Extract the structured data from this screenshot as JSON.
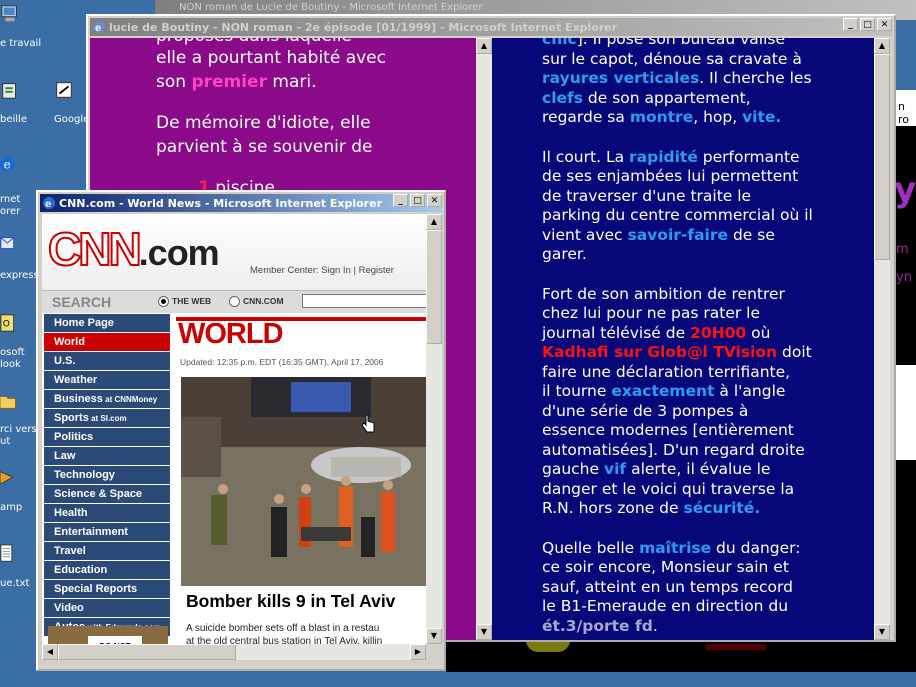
{
  "desktop": {
    "icons": [
      {
        "label": "e travail",
        "icon": "my-computer-icon"
      },
      {
        "label": "beille",
        "icon": "recycle-bin-icon"
      },
      {
        "label": "Google",
        "icon": "google-shortcut-icon"
      },
      {
        "label": "rnet",
        "label2": "orer",
        "icon": "internet-explorer-icon"
      },
      {
        "label": "express",
        "icon": "outlook-express-icon"
      },
      {
        "label": "osoft",
        "label2": "look",
        "icon": "outlook-icon"
      },
      {
        "label": "rci vers",
        "label2": "ut",
        "icon": "folder-shortcut-icon"
      },
      {
        "label": "amp",
        "icon": "winamp-icon"
      },
      {
        "label": "ue.txt",
        "icon": "text-file-icon"
      }
    ],
    "bg_window_title": "NON roman de Lucie de Boutiny - Microsoft Internet Explorer",
    "right_fragments": [
      "n ro",
      "y",
      "m",
      "yn"
    ]
  },
  "lucie_window": {
    "title": "lucie de Boutiny - NON roman - 2e épisode [01/1999] - Microsoft Internet Explorer",
    "left_lines": [
      {
        "text": "elle a pourtant habité avec"
      },
      {
        "pre": "son ",
        "hl": "premier",
        "post": " mari."
      }
    ],
    "left_para2": [
      "De mémoire d'idiote, elle",
      "parvient à   se souvenir de"
    ],
    "left_partial_top": "proposés dans laquelle",
    "left_list": {
      "num": "1",
      "text": " piscine"
    },
    "right_top": {
      "hl1": "chic",
      "t1": "]. Il pose son bureau valise"
    },
    "right_p1": [
      [
        {
          "t": "sur le capot, dénoue sa cravate à"
        }
      ],
      [
        {
          "h": "rayures verticales"
        },
        {
          "t": ". Il cherche les"
        }
      ],
      [
        {
          "h": "clefs"
        },
        {
          "t": " de son appartement,"
        }
      ],
      [
        {
          "t": "regarde sa "
        },
        {
          "h": "montre"
        },
        {
          "t": ", hop, "
        },
        {
          "h": "vite."
        }
      ]
    ],
    "right_p2": [
      [
        {
          "t": "Il court. La "
        },
        {
          "h": "rapidité"
        },
        {
          "t": " performante"
        }
      ],
      [
        {
          "t": "de ses enjambées lui permettent"
        }
      ],
      [
        {
          "t": "de traverser d'une traite le"
        }
      ],
      [
        {
          "t": "parking du centre commercial où il"
        }
      ],
      [
        {
          "t": "vient avec "
        },
        {
          "h": "savoir-faire"
        },
        {
          "t": " de se"
        }
      ],
      [
        {
          "t": "garer."
        }
      ]
    ],
    "right_p3": [
      [
        {
          "t": "Fort de son ambition de rentrer"
        }
      ],
      [
        {
          "t": "chez lui pour ne pas rater le"
        }
      ],
      [
        {
          "t": "journal télévisé de "
        },
        {
          "r": "20H00"
        },
        {
          "t": " où"
        }
      ],
      [
        {
          "r": "Kadhafi sur Glob@l TVision"
        },
        {
          "t": " doit"
        }
      ],
      [
        {
          "t": "faire une déclaration terrifiante,"
        }
      ],
      [
        {
          "t": "il tourne "
        },
        {
          "h": "exactement"
        },
        {
          "t": " à l'angle"
        }
      ],
      [
        {
          "t": "d'une série de 3 pompes à"
        }
      ],
      [
        {
          "t": "essence modernes [entièrement"
        }
      ],
      [
        {
          "t": "automatisées]. D'un regard droite"
        }
      ],
      [
        {
          "t": "gauche "
        },
        {
          "h": "vif"
        },
        {
          "t": " alerte, il évalue le"
        }
      ],
      [
        {
          "t": "danger et le voici qui traverse la"
        }
      ],
      [
        {
          "t": "R.N. hors zone de "
        },
        {
          "h": "sécurité."
        }
      ]
    ],
    "right_p4": [
      [
        {
          "t": "Quelle belle "
        },
        {
          "h": "maîtrise"
        },
        {
          "t": " du danger:"
        }
      ],
      [
        {
          "t": "ce soir encore, Monsieur sain et"
        }
      ],
      [
        {
          "t": "sauf, atteint en un temps record"
        }
      ],
      [
        {
          "t": "le B1-Emeraude en direction du"
        }
      ],
      [
        {
          "g": "ét.3/porte fd"
        },
        {
          "t": "."
        }
      ]
    ]
  },
  "cnn_window": {
    "title": "CNN.com - World News - Microsoft Internet Explorer",
    "logo": "CNN.com",
    "member_center": "Member Center: Sign In | Register",
    "search_label": "SEARCH",
    "radio_web": "THE WEB",
    "radio_cnn": "CNN.COM",
    "nav": [
      {
        "label": "Home Page"
      },
      {
        "label": "World",
        "selected": true
      },
      {
        "label": "U.S."
      },
      {
        "label": "Weather"
      },
      {
        "label": "Business",
        "suffix": " at CNNMoney"
      },
      {
        "label": "Sports",
        "suffix": " at SI.com"
      },
      {
        "label": "Politics"
      },
      {
        "label": "Law"
      },
      {
        "label": "Technology"
      },
      {
        "label": "Science & Space"
      },
      {
        "label": "Health"
      },
      {
        "label": "Entertainment"
      },
      {
        "label": "Travel"
      },
      {
        "label": "Education"
      },
      {
        "label": "Special Reports"
      },
      {
        "label": "Video"
      },
      {
        "label": "Autos",
        "suffix": " with Edmunds.com"
      }
    ],
    "section_title": "WORLD",
    "updated": "Updated: 12:35 p.m. EDT (16:35 GMT), April 17, 2006",
    "headline": "Bomber kills 9 in Tel Aviv",
    "summary_lines": [
      "A suicide bomber sets off a blast in a restau",
      "at the old central bus station in Tel Aviv, killin"
    ],
    "promo_text": "DO NOT"
  },
  "colors": {
    "desktop": "#3a6ea5",
    "purple_bg": "#8a0a8a",
    "navy_bg": "#06087a",
    "link_blue": "#2c9cf0",
    "alert_red": "#ff1010",
    "cnn_red": "#cc0000",
    "cnn_nav": "#2c4a78"
  }
}
